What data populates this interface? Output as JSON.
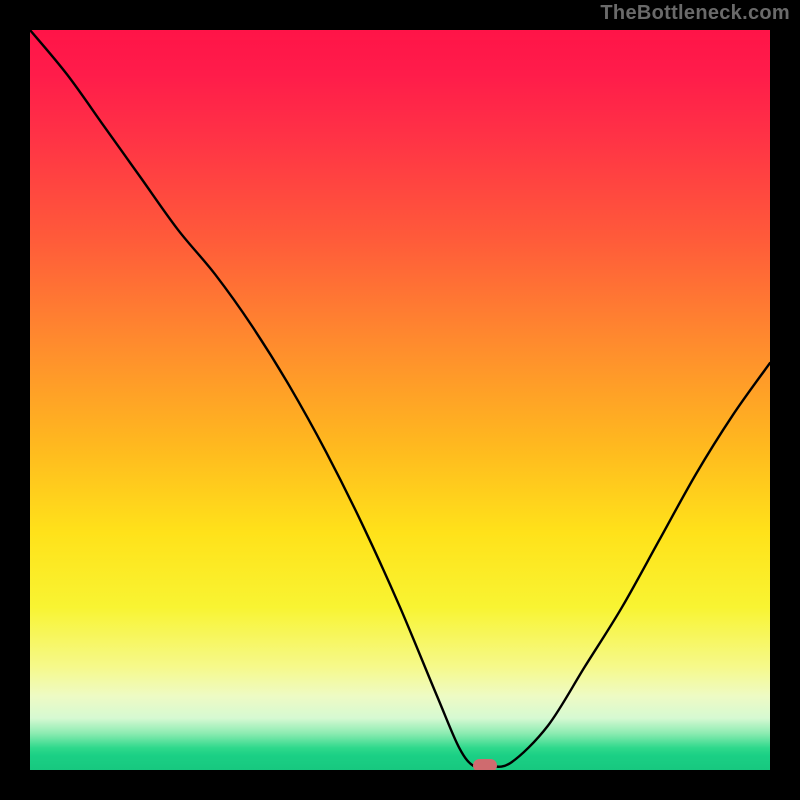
{
  "watermark": "TheBottleneck.com",
  "marker": {
    "cx_frac": 0.615,
    "cy_frac": 0.993
  },
  "chart_data": {
    "type": "line",
    "title": "",
    "xlabel": "",
    "ylabel": "",
    "xlim": [
      0,
      1
    ],
    "ylim": [
      0,
      1
    ],
    "x": [
      0.0,
      0.05,
      0.1,
      0.15,
      0.2,
      0.25,
      0.3,
      0.35,
      0.4,
      0.45,
      0.5,
      0.55,
      0.58,
      0.6,
      0.62,
      0.65,
      0.7,
      0.75,
      0.8,
      0.85,
      0.9,
      0.95,
      1.0
    ],
    "values": [
      1.0,
      0.94,
      0.87,
      0.8,
      0.73,
      0.67,
      0.6,
      0.52,
      0.43,
      0.33,
      0.22,
      0.1,
      0.03,
      0.005,
      0.005,
      0.01,
      0.06,
      0.14,
      0.22,
      0.31,
      0.4,
      0.48,
      0.55
    ],
    "annotations": [
      {
        "type": "marker",
        "x": 0.615,
        "y": 0.007,
        "color": "#cf6b6f"
      }
    ],
    "background_gradient": {
      "top": "#ff1448",
      "bottom": "#17c87f",
      "note": "smooth rainbow red→orange→yellow→pale→green"
    }
  }
}
